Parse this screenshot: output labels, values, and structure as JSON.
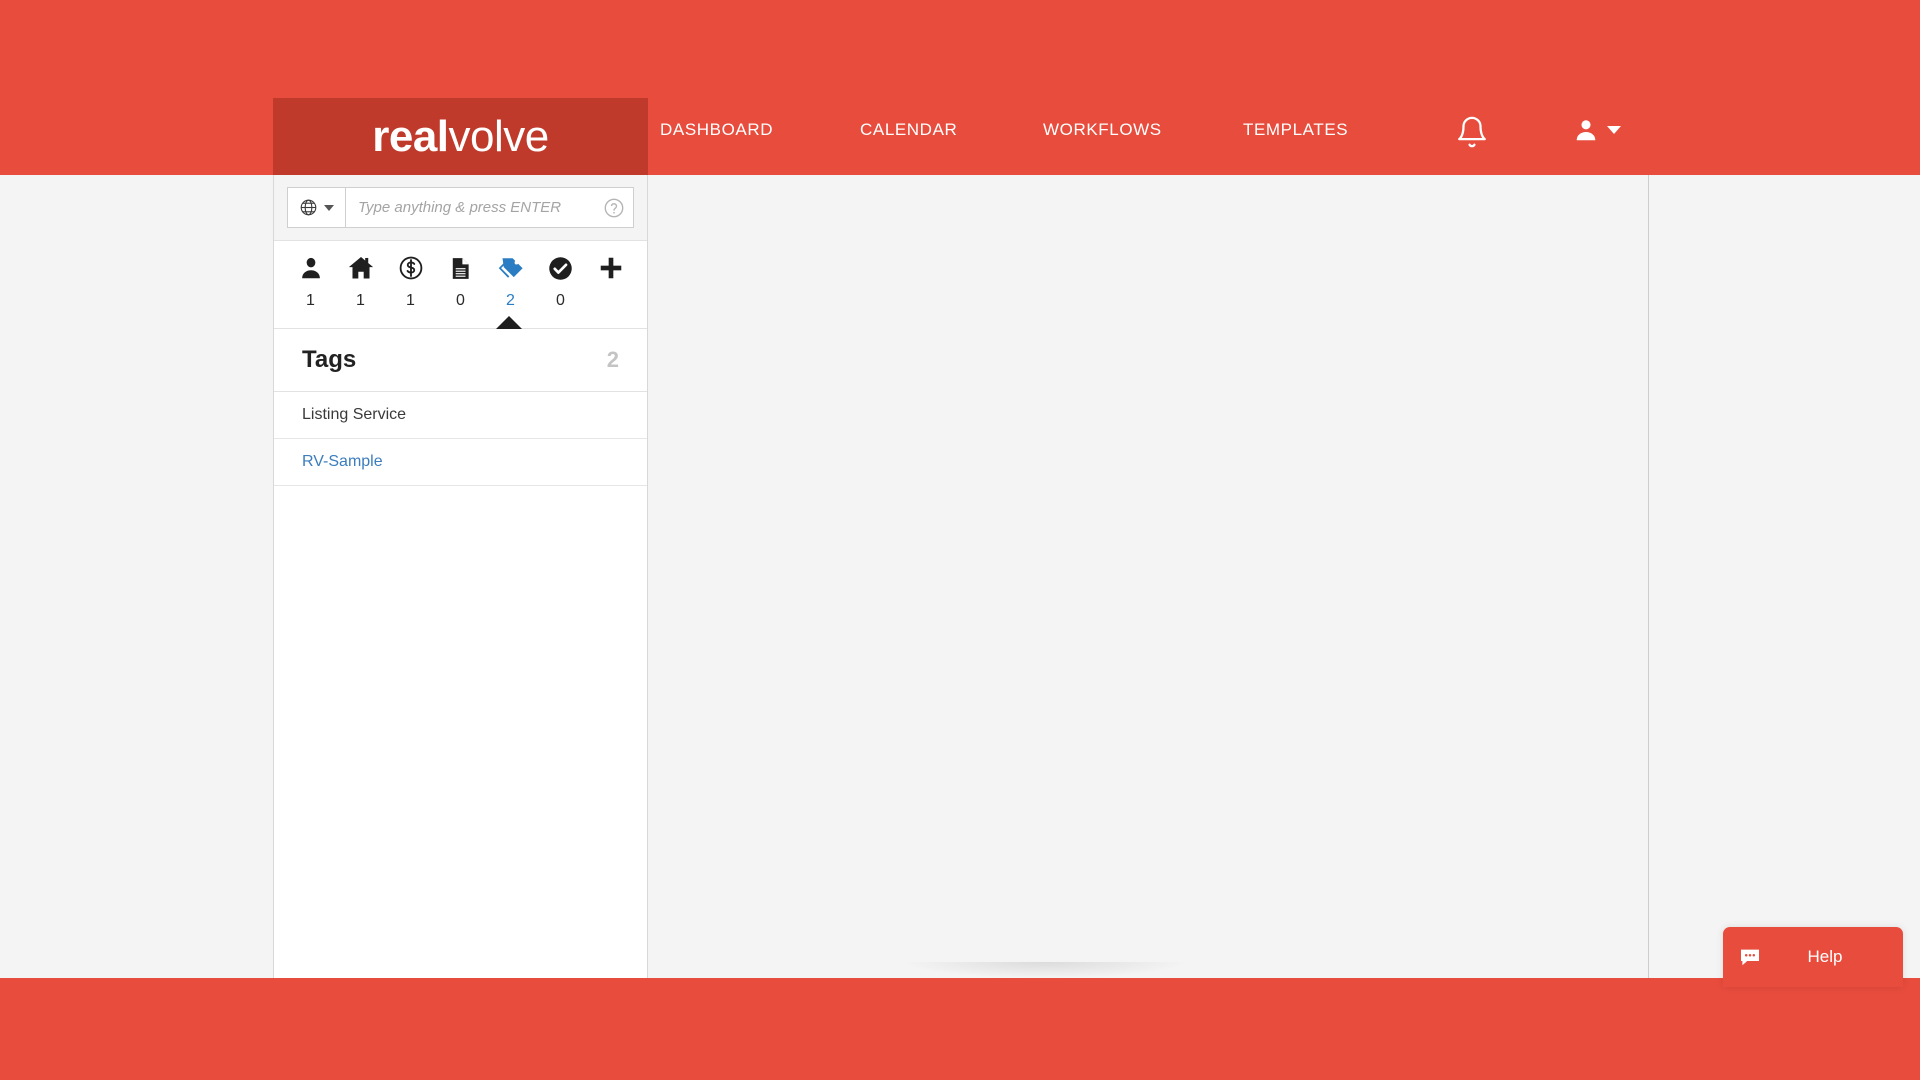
{
  "brand": {
    "logo_bold": "real",
    "logo_light": "volve",
    "header_color": "#e84c3d",
    "logo_block_color": "#c03a2b",
    "accent_blue": "#2b7dc3"
  },
  "header": {
    "nav": [
      {
        "label": "DASHBOARD",
        "name": "nav-dashboard"
      },
      {
        "label": "CALENDAR",
        "name": "nav-calendar"
      },
      {
        "label": "WORKFLOWS",
        "name": "nav-workflows"
      },
      {
        "label": "TEMPLATES",
        "name": "nav-templates"
      }
    ],
    "notifications_icon": "bell-icon",
    "user_icon": "user-avatar-icon",
    "user_caret": "chevron-down-icon"
  },
  "search": {
    "scope_icon": "globe-icon",
    "scope_caret": "chevron-down-icon",
    "placeholder": "Type anything & press ENTER",
    "value": "",
    "help_icon": "question-circle-icon"
  },
  "entity_tabs": [
    {
      "icon": "person-icon",
      "count": "1",
      "active": false
    },
    {
      "icon": "house-icon",
      "count": "1",
      "active": false
    },
    {
      "icon": "dollar-circle-icon",
      "count": "1",
      "active": false
    },
    {
      "icon": "document-icon",
      "count": "0",
      "active": false
    },
    {
      "icon": "tag-icon",
      "count": "2",
      "active": true
    },
    {
      "icon": "check-circle-icon",
      "count": "0",
      "active": false
    },
    {
      "icon": "plus-icon",
      "count": "",
      "active": false
    }
  ],
  "panel": {
    "title": "Tags",
    "count": "2",
    "items": [
      {
        "label": "Listing Service",
        "style": "plain"
      },
      {
        "label": "RV-Sample",
        "style": "link"
      }
    ]
  },
  "help_widget": {
    "label": "Help",
    "icon": "chat-bubble-icon"
  }
}
